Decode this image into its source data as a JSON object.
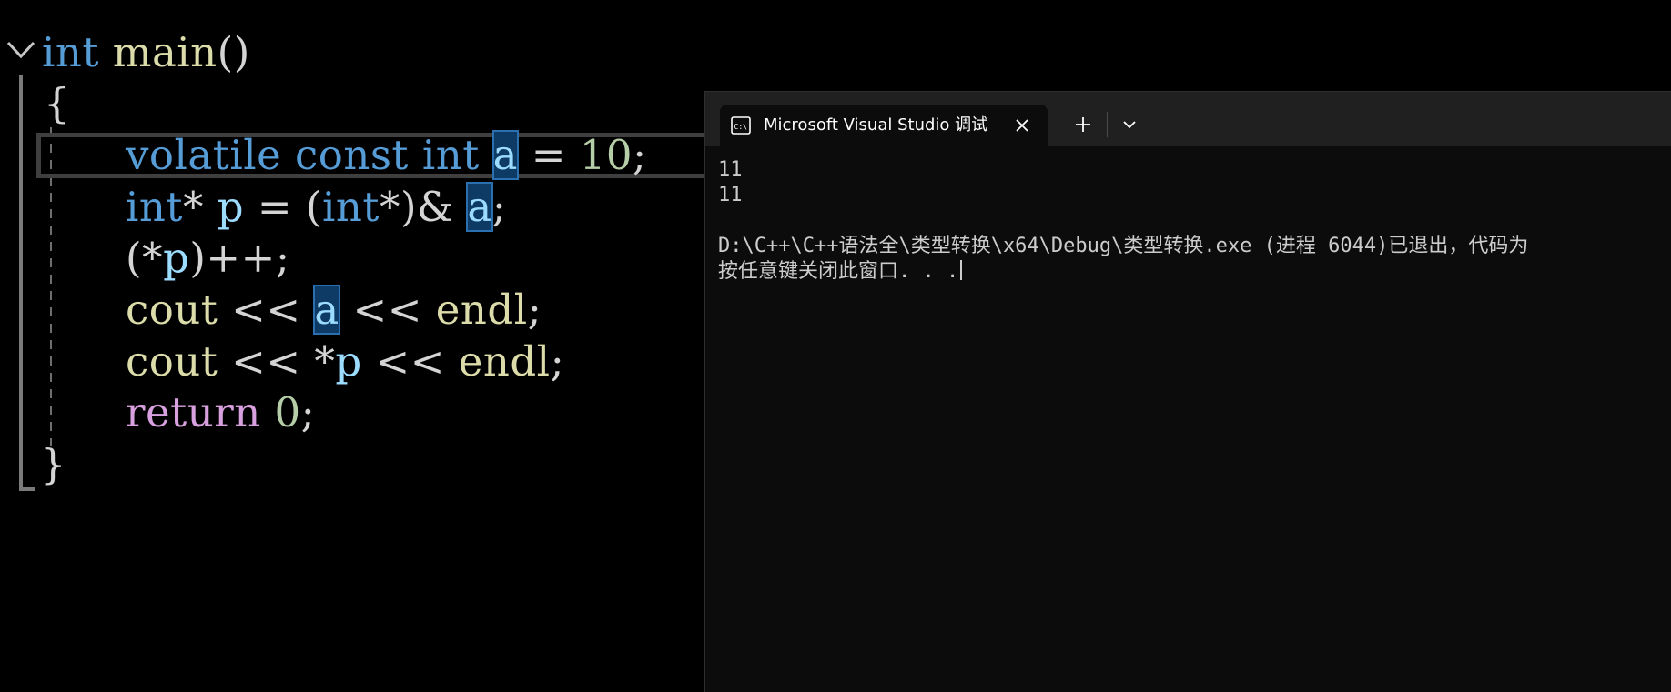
{
  "editor": {
    "lines": [
      {
        "tokens": [
          {
            "t": "int",
            "c": "kw"
          },
          {
            "t": " ",
            "c": "plain"
          },
          {
            "t": "main",
            "c": "fn"
          },
          {
            "t": "()",
            "c": "plain"
          }
        ]
      },
      {
        "tokens": [
          {
            "t": "{",
            "c": "plain"
          }
        ]
      },
      {
        "tokens": [
          {
            "t": "volatile",
            "c": "kw"
          },
          {
            "t": " ",
            "c": "plain"
          },
          {
            "t": "const",
            "c": "kw"
          },
          {
            "t": " ",
            "c": "plain"
          },
          {
            "t": "int",
            "c": "kw"
          },
          {
            "t": " ",
            "c": "plain"
          },
          {
            "t": "a",
            "c": "hl"
          },
          {
            "t": " = ",
            "c": "plain"
          },
          {
            "t": "10",
            "c": "num"
          },
          {
            "t": ";",
            "c": "plain"
          }
        ]
      },
      {
        "tokens": [
          {
            "t": "int",
            "c": "kw"
          },
          {
            "t": "* ",
            "c": "plain"
          },
          {
            "t": "p",
            "c": "var"
          },
          {
            "t": " = (",
            "c": "plain"
          },
          {
            "t": "int",
            "c": "kw"
          },
          {
            "t": "*)& ",
            "c": "plain"
          },
          {
            "t": "a",
            "c": "hl"
          },
          {
            "t": ";",
            "c": "plain"
          }
        ]
      },
      {
        "tokens": [
          {
            "t": "(*",
            "c": "plain"
          },
          {
            "t": "p",
            "c": "var"
          },
          {
            "t": ")++;",
            "c": "plain"
          }
        ]
      },
      {
        "tokens": [
          {
            "t": "cout",
            "c": "fn"
          },
          {
            "t": " << ",
            "c": "plain"
          },
          {
            "t": "a",
            "c": "hl"
          },
          {
            "t": " << ",
            "c": "plain"
          },
          {
            "t": "endl",
            "c": "fn"
          },
          {
            "t": ";",
            "c": "plain"
          }
        ]
      },
      {
        "tokens": [
          {
            "t": "cout",
            "c": "fn"
          },
          {
            "t": " << *",
            "c": "plain"
          },
          {
            "t": "p",
            "c": "var"
          },
          {
            "t": " << ",
            "c": "plain"
          },
          {
            "t": "endl",
            "c": "fn"
          },
          {
            "t": ";",
            "c": "plain"
          }
        ]
      },
      {
        "tokens": [
          {
            "t": "return",
            "c": "ret"
          },
          {
            "t": " ",
            "c": "plain"
          },
          {
            "t": "0",
            "c": "num"
          },
          {
            "t": ";",
            "c": "plain"
          }
        ]
      },
      {
        "tokens": [
          {
            "t": "}",
            "c": "plain"
          }
        ]
      }
    ]
  },
  "terminal": {
    "tab_title": "Microsoft Visual Studio 调试控制台",
    "tab_icon": "console-app-icon",
    "close_icon": "close-icon",
    "new_tab_icon": "plus-icon",
    "dropdown_icon": "chevron-down-icon",
    "output": [
      "11",
      "11",
      "",
      "D:\\C++\\C++语法全\\类型转换\\x64\\Debug\\类型转换.exe (进程 6044)已退出，代码为",
      "按任意键关闭此窗口. . ."
    ]
  }
}
